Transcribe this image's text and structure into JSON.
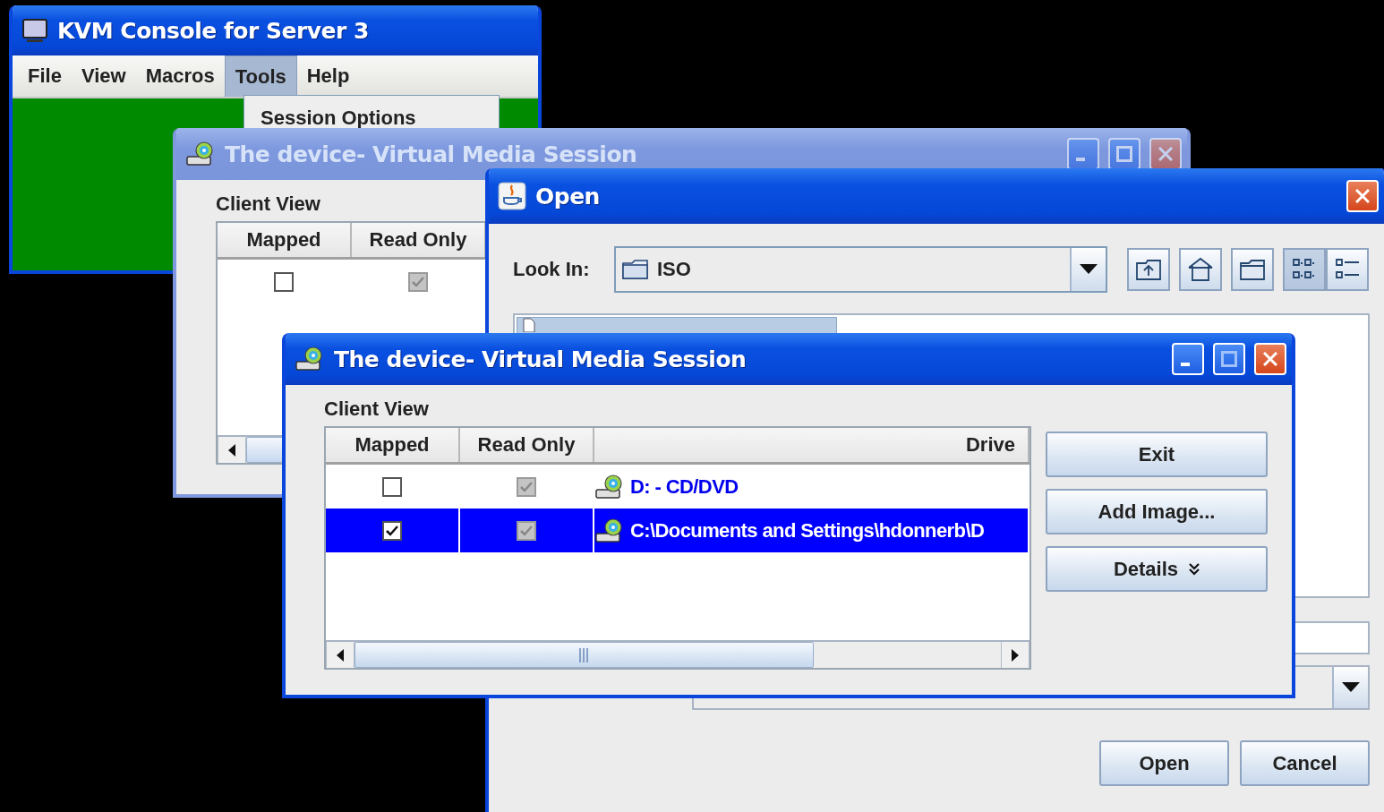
{
  "kvm_window": {
    "title": "KVM Console for Server 3",
    "active": true,
    "menu": [
      {
        "label": "File",
        "selected": false
      },
      {
        "label": "View",
        "selected": false
      },
      {
        "label": "Macros",
        "selected": false
      },
      {
        "label": "Tools",
        "selected": true
      },
      {
        "label": "Help",
        "selected": false
      }
    ],
    "dropdown": {
      "items": [
        "Session Options"
      ]
    }
  },
  "back_session_window": {
    "title": "The device- Virtual Media Session",
    "active": false,
    "section_label": "Client View",
    "columns": [
      "Mapped",
      "Read Only"
    ],
    "rows": [
      {
        "mapped": {
          "checked": false,
          "disabled": false
        },
        "read_only": {
          "checked": true,
          "disabled": true
        }
      }
    ]
  },
  "open_dialog": {
    "title": "Open",
    "active": true,
    "look_in_label": "Look In:",
    "look_in_value": "ISO",
    "views": [
      {
        "kind": "list",
        "selected": true
      },
      {
        "kind": "details",
        "selected": false
      }
    ],
    "buttons": [
      "Open",
      "Cancel"
    ]
  },
  "session_window": {
    "title": "The device- Virtual Media Session",
    "active": true,
    "section_label": "Client View",
    "columns": [
      "Mapped",
      "Read Only",
      "Drive"
    ],
    "rows": [
      {
        "mapped": {
          "checked": false,
          "disabled": false
        },
        "read_only": {
          "checked": true,
          "disabled": true
        },
        "drive": "D: - CD/DVD",
        "selected": false
      },
      {
        "mapped": {
          "checked": true,
          "disabled": false
        },
        "read_only": {
          "checked": true,
          "disabled": true
        },
        "drive": "C:\\Documents and Settings\\hdonnerb\\D",
        "selected": true
      }
    ],
    "buttons": [
      {
        "label": "Exit",
        "kind": "plain"
      },
      {
        "label": "Add Image...",
        "kind": "plain"
      },
      {
        "label": "Details",
        "kind": "menu"
      }
    ]
  }
}
